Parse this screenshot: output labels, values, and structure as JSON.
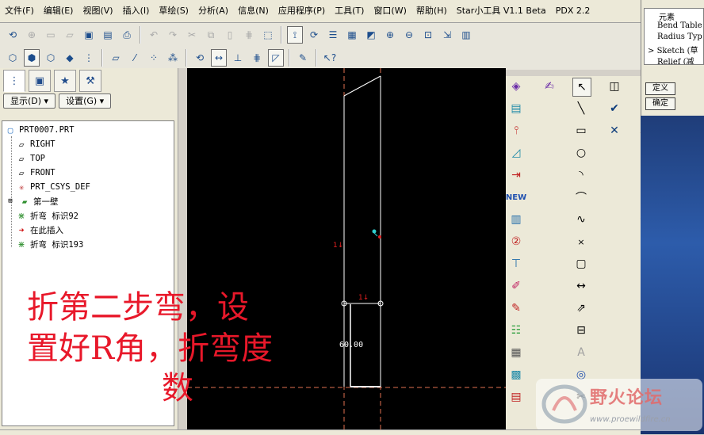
{
  "menubar": {
    "items": [
      "文件(F)",
      "编辑(E)",
      "视图(V)",
      "插入(I)",
      "草绘(S)",
      "分析(A)",
      "信息(N)",
      "应用程序(P)",
      "工具(T)",
      "窗口(W)",
      "帮助(H)",
      "Star小工具 V1.1 Beta",
      "PDX 2.2"
    ]
  },
  "panel": {
    "display_label": "显示(D) ▾",
    "settings_label": "设置(G) ▾"
  },
  "tree": {
    "root": "PRT0007.PRT",
    "items": [
      "RIGHT",
      "TOP",
      "FRONT",
      "PRT_CSYS_DEF",
      "第一壁",
      "折弯 标识92",
      "在此插入",
      "折弯 标识193"
    ]
  },
  "canvas": {
    "dimension": "60.00",
    "marker": "1↓"
  },
  "caption": {
    "line1": "折第二步弯，设",
    "line2": "置好R角，折弯度",
    "line3": "数"
  },
  "dialog": {
    "header": "元素",
    "rows": [
      "Bend Table",
      "Radius Typ",
      "Sketch (草",
      "Relief (减"
    ],
    "define_label": "定义",
    "ok_label": "确定"
  },
  "watermark": {
    "title": "野火论坛",
    "url": "www.proewildfire.cn"
  },
  "colors": {
    "canvas_bg": "#000000",
    "caption": "#e8182a",
    "guide": "#e07050",
    "sketch": "#ffffff"
  }
}
